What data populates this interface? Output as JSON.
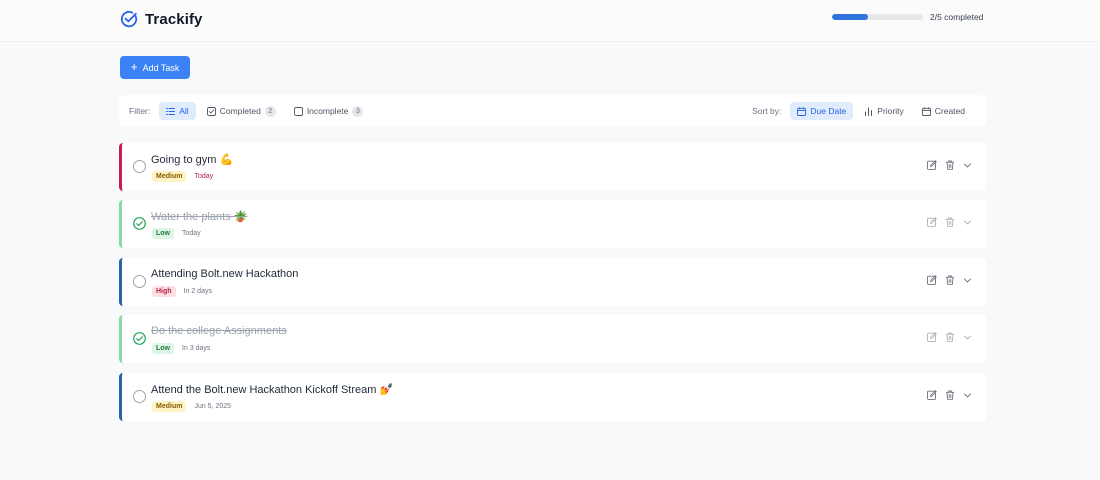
{
  "app": {
    "title": "Trackify"
  },
  "progress": {
    "text": "2/5 completed",
    "fraction": 0.4
  },
  "add_task_label": "Add Task",
  "filter": {
    "label": "Filter:",
    "options": [
      {
        "label": "All",
        "count": null,
        "active": true
      },
      {
        "label": "Completed",
        "count": "2",
        "active": false
      },
      {
        "label": "Incomplete",
        "count": "3",
        "active": false
      }
    ]
  },
  "sort": {
    "label": "Sort by:",
    "options": [
      {
        "label": "Due Date",
        "active": true
      },
      {
        "label": "Priority",
        "active": false
      },
      {
        "label": "Created",
        "active": false
      }
    ]
  },
  "tasks": [
    {
      "title": "Going to gym 💪",
      "priority": "Medium",
      "due": "Today",
      "completed": false
    },
    {
      "title": "Water the plants 🪴",
      "priority": "Low",
      "due": "Today",
      "completed": true
    },
    {
      "title": "Attending Bolt.new Hackathon",
      "priority": "High",
      "due": "In 2 days",
      "completed": false
    },
    {
      "title": "Do the college Assignments",
      "priority": "Low",
      "due": "In 3 days",
      "completed": true
    },
    {
      "title": "Attend the Bolt.new Hackathon Kickoff Stream 💅",
      "priority": "Medium",
      "due": "Jun 5, 2025",
      "completed": false
    }
  ],
  "colors": {
    "accent": "#3b82f6",
    "progress": "#2f74de",
    "check": "#22a35a"
  }
}
